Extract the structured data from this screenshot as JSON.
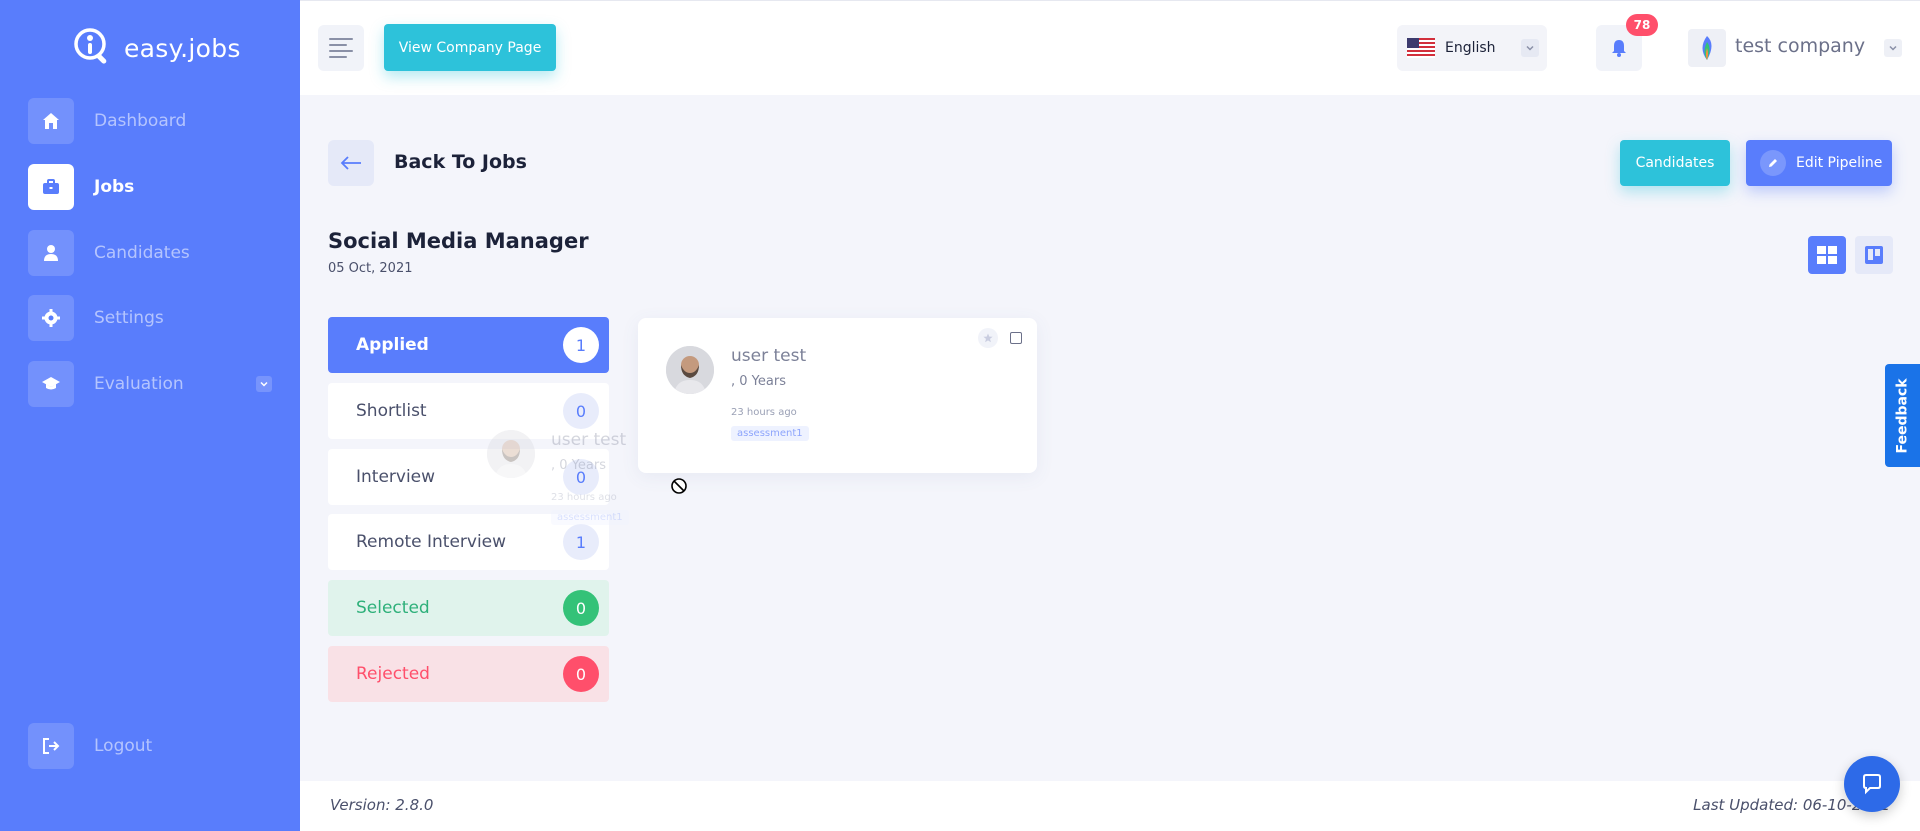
{
  "brand": {
    "name": "easy.jobs"
  },
  "sidebar": {
    "items": [
      {
        "label": "Dashboard",
        "icon": "home-icon",
        "active": false
      },
      {
        "label": "Jobs",
        "icon": "briefcase-icon",
        "active": true
      },
      {
        "label": "Candidates",
        "icon": "user-icon",
        "active": false
      },
      {
        "label": "Settings",
        "icon": "gear-icon",
        "active": false
      },
      {
        "label": "Evaluation",
        "icon": "graduation-cap-icon",
        "active": false
      }
    ],
    "logout": "Logout"
  },
  "topbar": {
    "view_company_page": "View Company Page",
    "language": "English",
    "notifications_count": "78",
    "company_name": "test company"
  },
  "header": {
    "back": "Back To Jobs",
    "candidates_button": "Candidates",
    "edit_pipeline_button": "Edit Pipeline"
  },
  "job": {
    "title": "Social Media Manager",
    "date": "05 Oct, 2021"
  },
  "stages": [
    {
      "label": "Applied",
      "count": "1"
    },
    {
      "label": "Shortlist",
      "count": "0"
    },
    {
      "label": "Interview",
      "count": "0"
    },
    {
      "label": "Remote Interview",
      "count": "1"
    },
    {
      "label": "Selected",
      "count": "0"
    },
    {
      "label": "Rejected",
      "count": "0"
    }
  ],
  "candidate": {
    "name": "user test",
    "experience": ", 0 Years",
    "time": "23 hours ago",
    "tag": "assessment1"
  },
  "footer": {
    "version": "Version: 2.8.0",
    "last_updated": "Last Updated: 06-10-2021"
  },
  "feedback": "Feedback",
  "colors": {
    "primary": "#597dfc",
    "teal": "#2dc2da",
    "success": "#34c278",
    "danger": "#ff4f6b"
  }
}
